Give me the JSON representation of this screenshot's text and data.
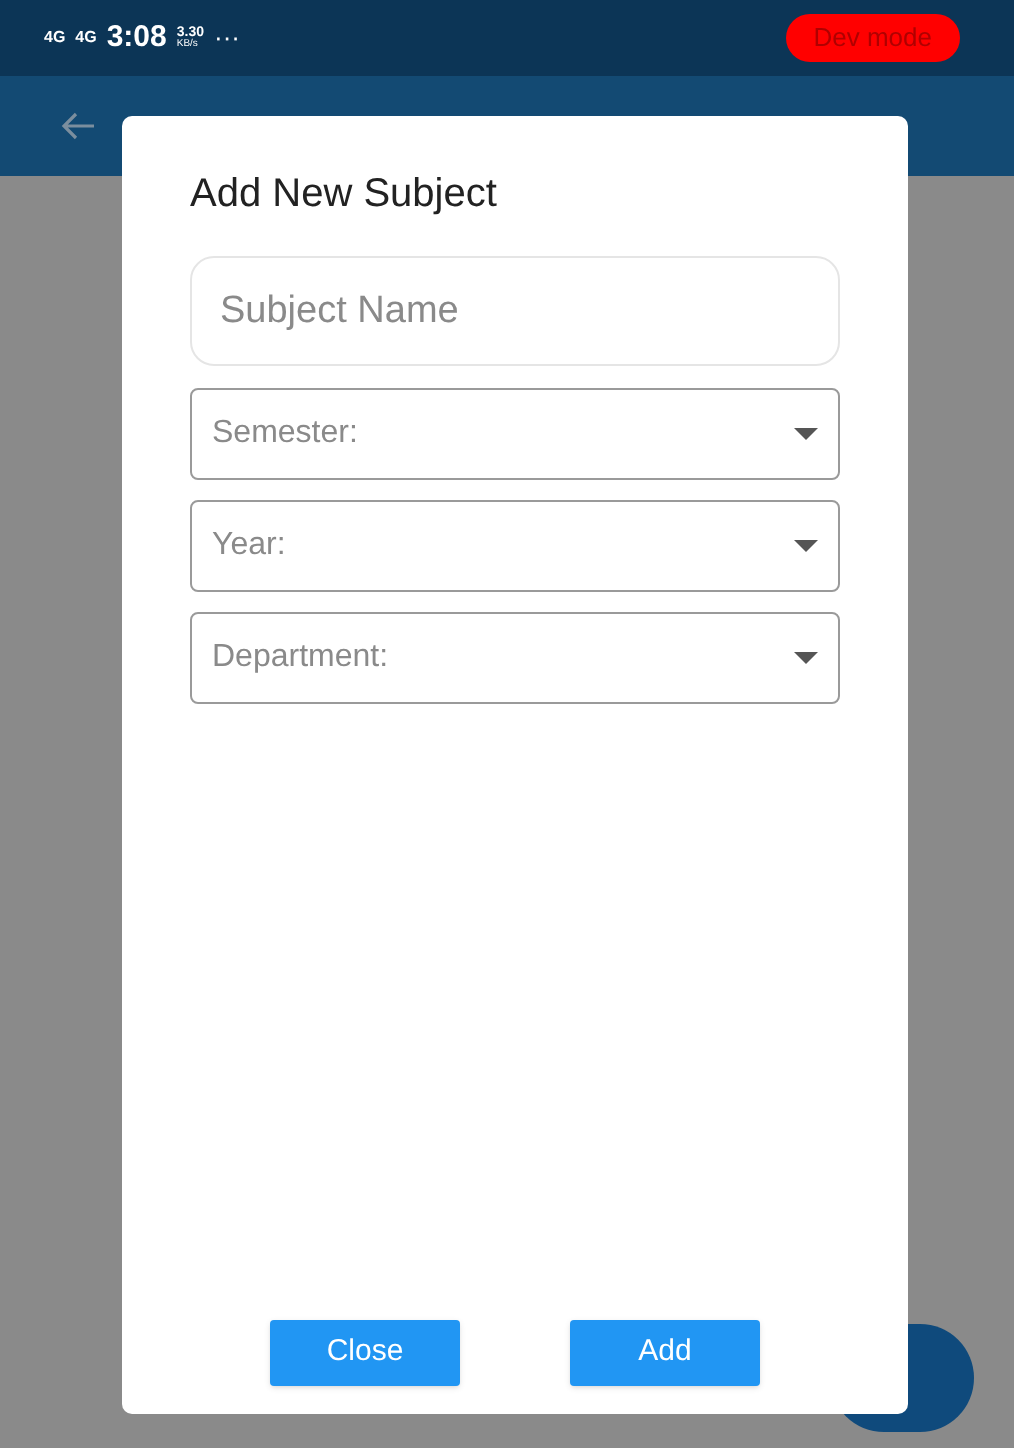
{
  "status_bar": {
    "network_1": "4G",
    "network_2": "4G",
    "time": "3:08",
    "speed": "3.30",
    "speed_unit": "KB/s",
    "more": "···",
    "badge": "Dev mode"
  },
  "dialog": {
    "title": "Add New Subject",
    "fields": [
      {
        "kind": "text",
        "placeholder": "Subject Name"
      },
      {
        "kind": "select",
        "placeholder": "Semester:"
      },
      {
        "kind": "select",
        "placeholder": "Year:"
      },
      {
        "kind": "select",
        "placeholder": "Department:"
      }
    ],
    "buttons": [
      "Close",
      "Add"
    ]
  }
}
